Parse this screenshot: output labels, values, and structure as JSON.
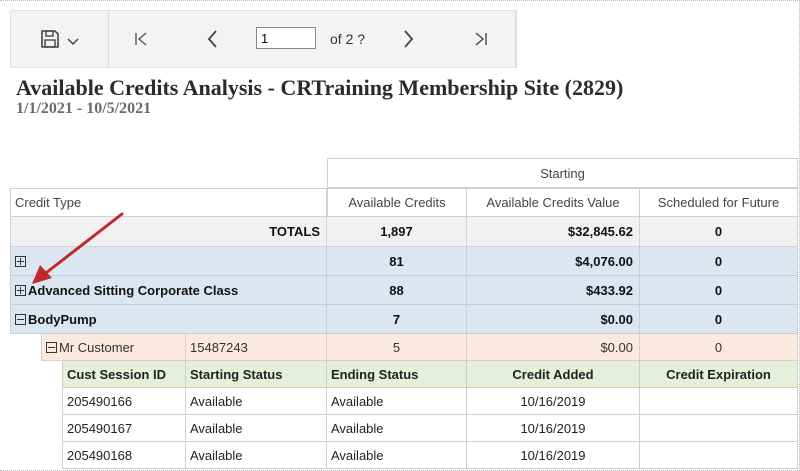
{
  "toolbar": {
    "page_value": "1",
    "page_of": "of 2 ?"
  },
  "report": {
    "title": "Available Credits Analysis - CRTraining Membership Site (2829)",
    "date_range": "1/1/2021 - 10/5/2021"
  },
  "table": {
    "group_header": "Starting",
    "col_credit_type": "Credit Type",
    "col_available_credits": "Available Credits",
    "col_available_value": "Available Credits Value",
    "col_scheduled": "Scheduled for Future",
    "totals": {
      "label": "TOTALS",
      "credits": "1,897",
      "value": "$32,845.62",
      "scheduled": "0"
    },
    "groups": [
      {
        "label": "",
        "credits": "81",
        "value": "$4,076.00",
        "scheduled": "0"
      },
      {
        "label": "Advanced Sitting Corporate Class",
        "credits": "88",
        "value": "$433.92",
        "scheduled": "0"
      },
      {
        "label": "BodyPump",
        "credits": "7",
        "value": "$0.00",
        "scheduled": "0"
      }
    ],
    "customer": {
      "name": "Mr Customer",
      "id": "15487243",
      "credits": "5",
      "value": "$0.00",
      "scheduled": "0"
    },
    "detail_headers": [
      "Cust Session ID",
      "Starting Status",
      "Ending Status",
      "Credit Added",
      "Credit Expiration"
    ],
    "detail_rows": [
      [
        "205490166",
        "Available",
        "Available",
        "10/16/2019",
        ""
      ],
      [
        "205490167",
        "Available",
        "Available",
        "10/16/2019",
        ""
      ],
      [
        "205490168",
        "Available",
        "Available",
        "10/16/2019",
        ""
      ]
    ]
  },
  "colors": {
    "arrow": "#c0282d",
    "group_row": "#dce6f1",
    "customer_row": "#fbe9dd",
    "detail_header": "#e6efda"
  }
}
